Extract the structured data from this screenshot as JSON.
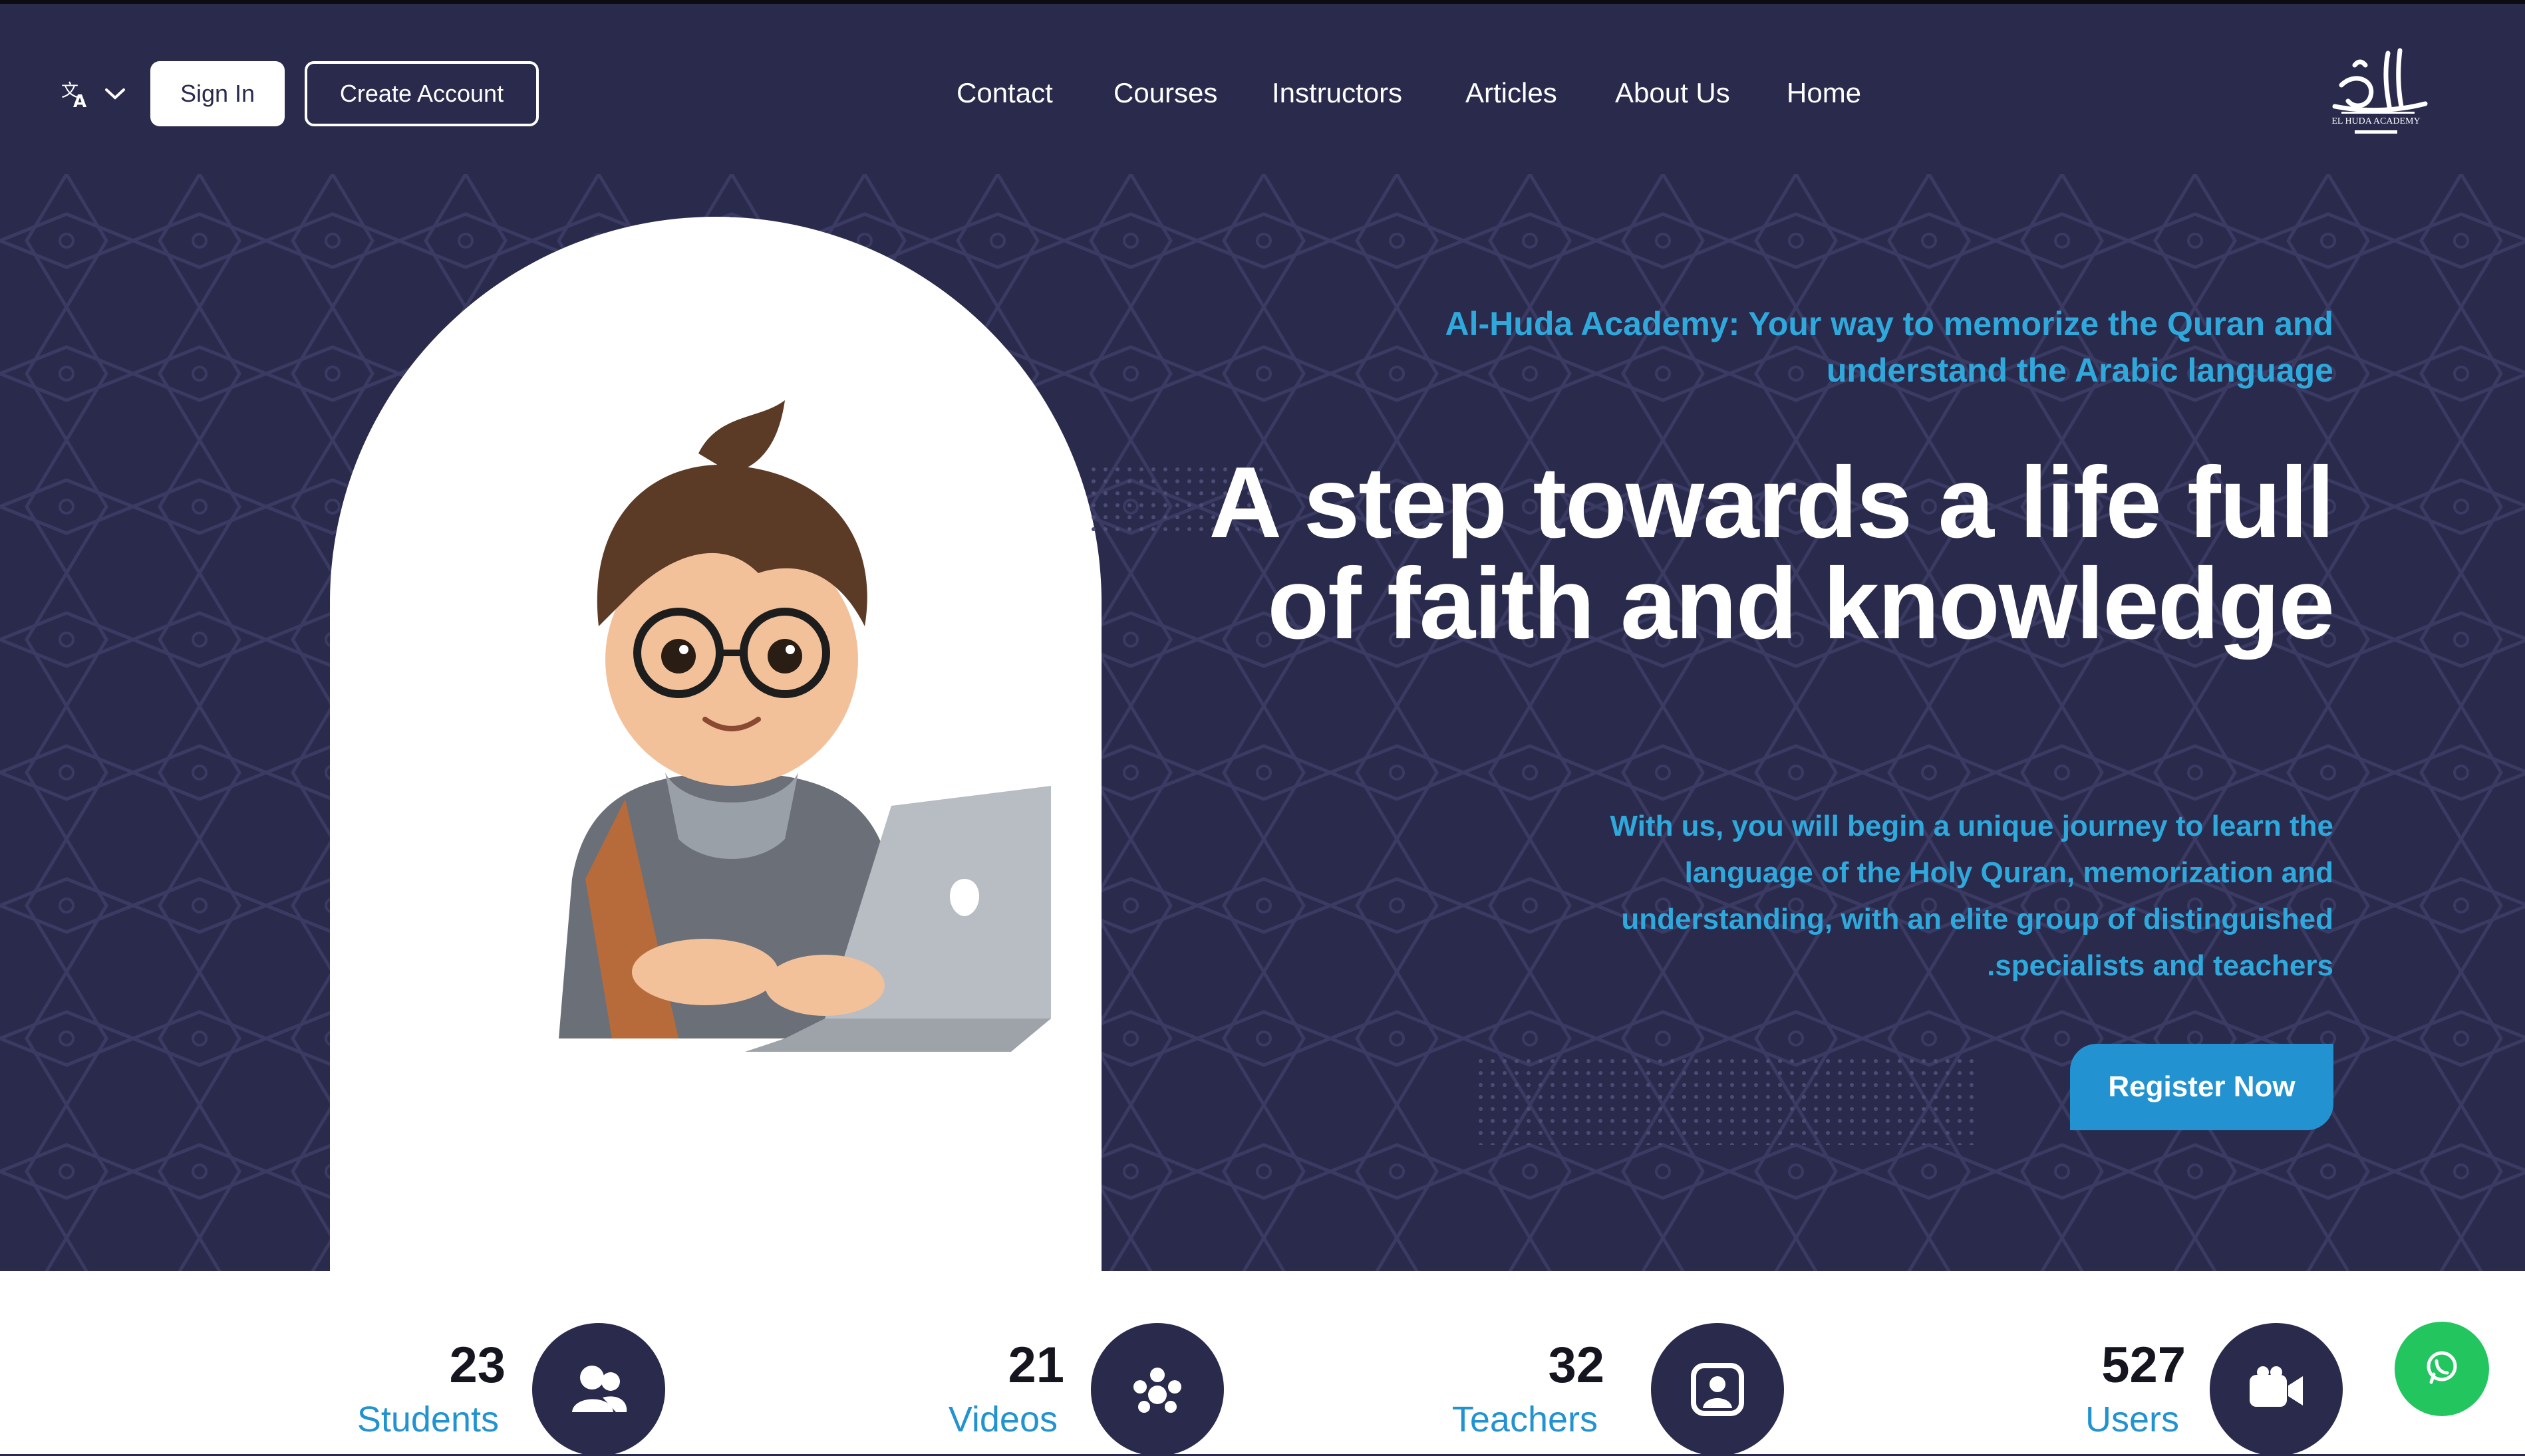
{
  "colors": {
    "background": "#2a2a4d",
    "accent": "#2fa8dc",
    "button": "#2293d0",
    "whatsapp": "#22c55e"
  },
  "header": {
    "language_icon": "translate-icon",
    "sign_in": "Sign In",
    "create_account": "Create Account",
    "nav": [
      "Contact",
      "Courses",
      "Instructors",
      "Articles",
      "About Us",
      "Home"
    ],
    "logo_text": "EL HUDA ACADEMY"
  },
  "hero": {
    "tagline": "Al-Huda Academy: Your way to memorize the Quran and understand the Arabic language",
    "headline": "A step towards a life full of faith and knowledge",
    "description": "With us, you will begin a unique journey to learn the language of the Holy Quran, memorization and understanding, with an elite group of distinguished .specialists and teachers",
    "register": "Register Now",
    "illustration": "boy with glasses using laptop"
  },
  "stats": [
    {
      "value": "23",
      "label": "Students",
      "icon": "users-icon"
    },
    {
      "value": "21",
      "label": "Videos",
      "icon": "group-icon"
    },
    {
      "value": "32",
      "label": "Teachers",
      "icon": "profile-icon"
    },
    {
      "value": "527",
      "label": "Users",
      "icon": "video-camera-icon"
    }
  ],
  "floating": {
    "icon": "whatsapp-icon"
  }
}
